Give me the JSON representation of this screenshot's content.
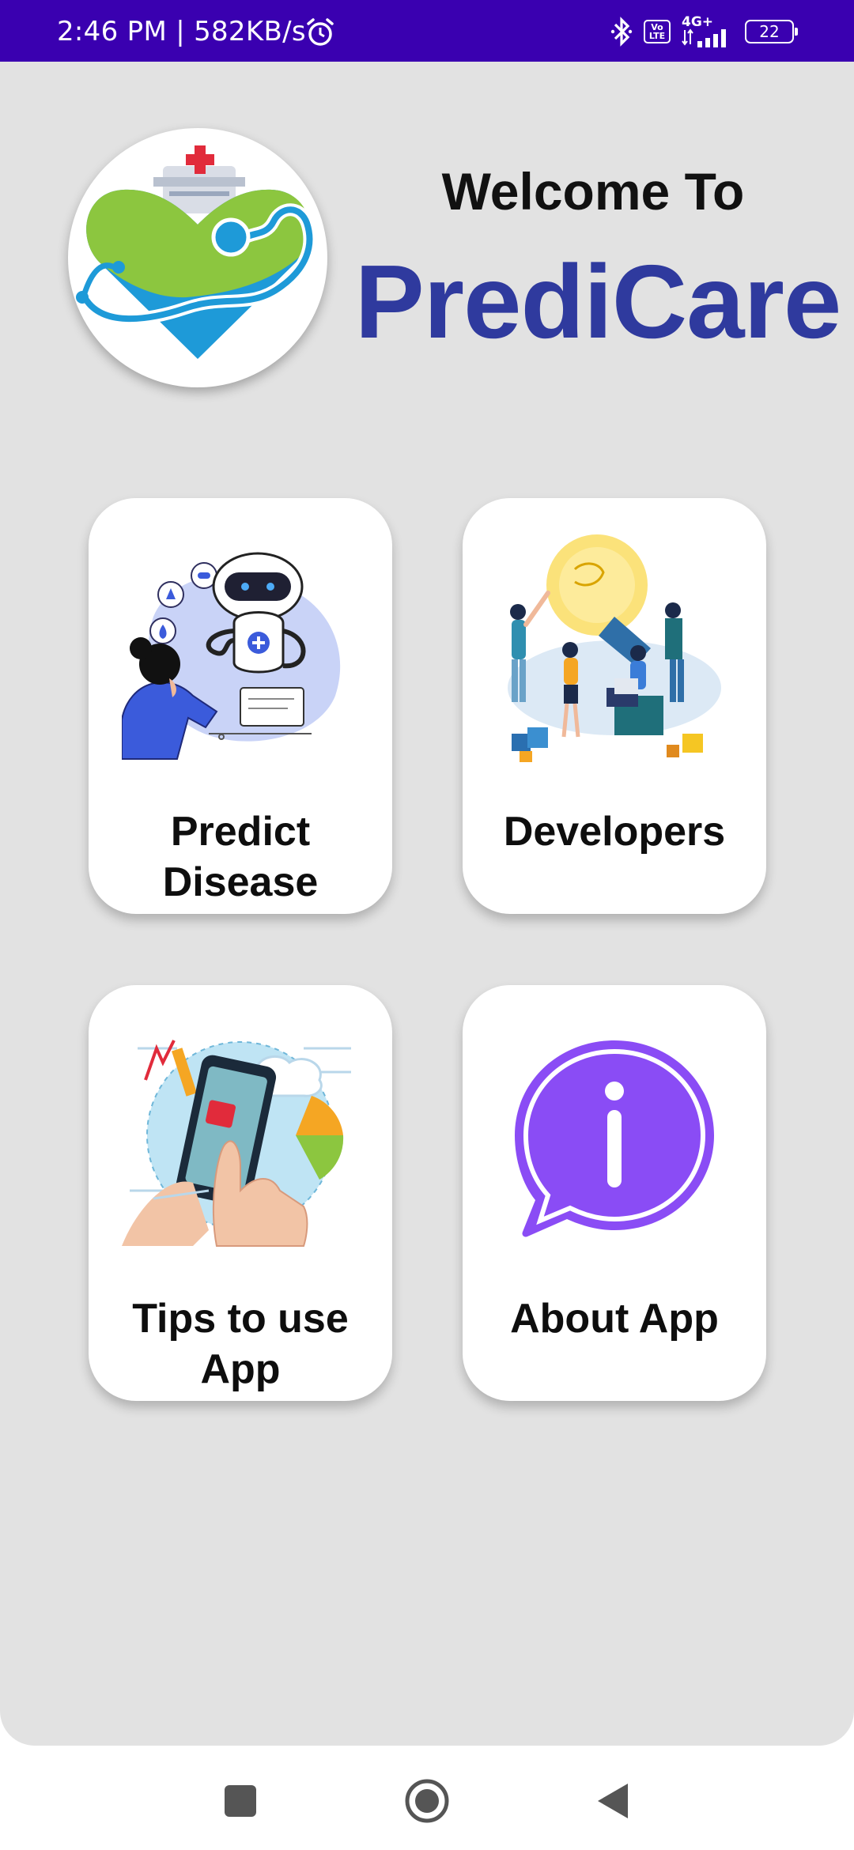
{
  "status_bar": {
    "time_speed": "2:46 PM | 582KB/s",
    "volte_line1": "Vo",
    "volte_line2": "LTE",
    "network": "4G+",
    "battery": "22",
    "icons": [
      "alarm-icon",
      "bluetooth-icon",
      "volte-icon",
      "signal-icon",
      "battery-icon"
    ]
  },
  "header": {
    "welcome": "Welcome To",
    "app_name": "PrediCare",
    "brand_color": "#2f3a9e"
  },
  "cards": {
    "predict": {
      "label_line1": "Predict",
      "label_line2": "Disease",
      "icon": "doctor-robot-illustration"
    },
    "developers": {
      "label": "Developers",
      "icon": "team-lightbulb-illustration"
    },
    "tips": {
      "label_line1": "Tips to use",
      "label_line2": "App",
      "icon": "phone-hand-illustration"
    },
    "about": {
      "label": "About App",
      "icon": "info-bubble-icon",
      "icon_color": "#8a4cf5"
    }
  },
  "nav_bar": {
    "buttons": [
      "recents-button",
      "home-button",
      "back-button"
    ]
  }
}
